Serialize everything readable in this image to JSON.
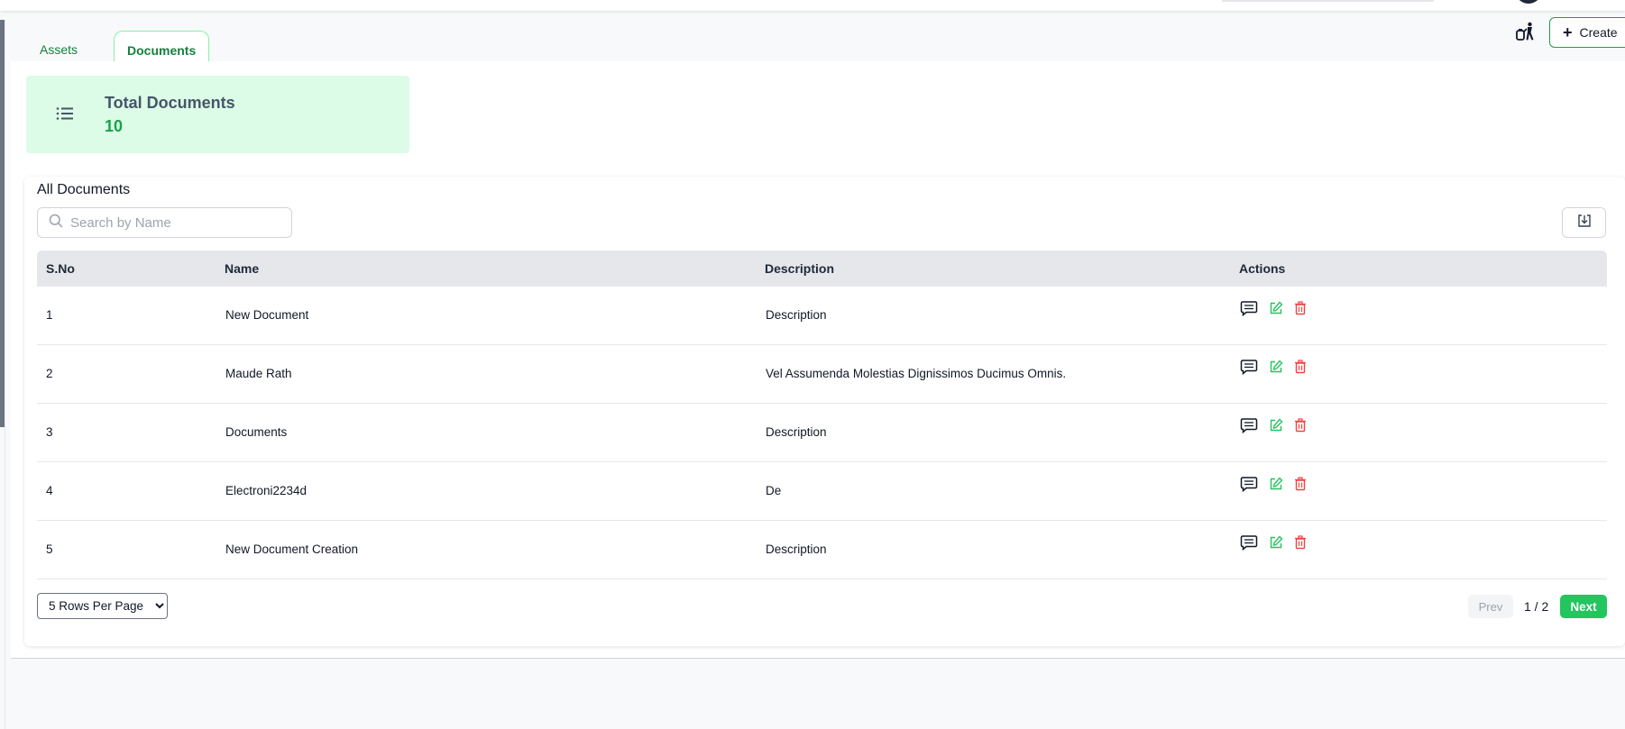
{
  "tabs": [
    {
      "label": "Assets",
      "active": false
    },
    {
      "label": "Documents",
      "active": true
    }
  ],
  "header": {
    "create_label": "Create",
    "accessibility_icon": "accessibility-icon"
  },
  "stat": {
    "title": "Total Documents",
    "value": "10",
    "icon": "list-icon"
  },
  "section": {
    "title": "All Documents",
    "search_placeholder": "Search by Name",
    "download_icon": "download-icon"
  },
  "table": {
    "columns": [
      "S.No",
      "Name",
      "Description",
      "Actions"
    ],
    "rows": [
      {
        "sno": "1",
        "name": "New Document",
        "description": "Description"
      },
      {
        "sno": "2",
        "name": "Maude Rath",
        "description": "Vel Assumenda Molestias Dignissimos Ducimus Omnis."
      },
      {
        "sno": "3",
        "name": "Documents",
        "description": "Description"
      },
      {
        "sno": "4",
        "name": "Electroni2234d",
        "description": "De"
      },
      {
        "sno": "5",
        "name": "New Document Creation",
        "description": "Description"
      }
    ],
    "row_action_icons": [
      "comment-icon",
      "edit-icon",
      "delete-icon"
    ]
  },
  "pagination": {
    "rows_per_page": "5 Rows Per Page",
    "prev_label": "Prev",
    "page_indicator": "1 / 2",
    "next_label": "Next"
  },
  "colors": {
    "accent": "#16a34a",
    "stat_bg": "#dcfce7",
    "edit": "#22c55e",
    "delete": "#ef4444"
  }
}
